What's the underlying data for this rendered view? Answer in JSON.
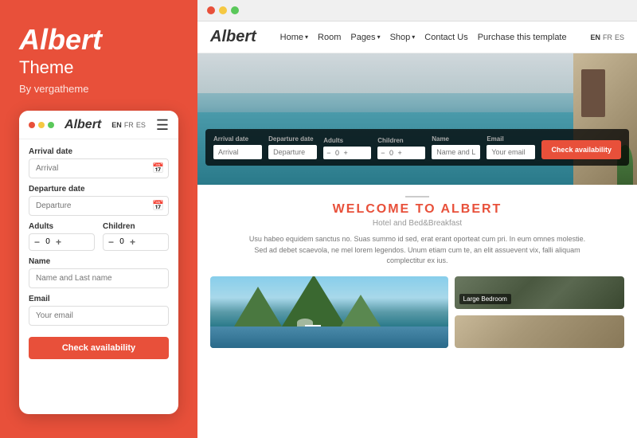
{
  "left": {
    "brand_title": "Albert",
    "brand_subtitle": "Theme",
    "brand_by": "By vergatheme",
    "mobile": {
      "logo": "Albert",
      "lang_options": [
        "EN",
        "FR",
        "ES"
      ],
      "lang_active": "EN",
      "form": {
        "arrival_label": "Arrival date",
        "arrival_placeholder": "Arrival",
        "departure_label": "Departure date",
        "departure_placeholder": "Departure",
        "adults_label": "Adults",
        "adults_value": "0",
        "children_label": "Children",
        "children_value": "0",
        "name_label": "Name",
        "name_placeholder": "Name and Last name",
        "email_label": "Email",
        "email_placeholder": "Your email",
        "check_btn": "Check availability"
      }
    }
  },
  "right": {
    "site": {
      "logo": "Albert",
      "nav": [
        {
          "label": "Home",
          "has_dropdown": true
        },
        {
          "label": "Room",
          "has_dropdown": false
        },
        {
          "label": "Pages",
          "has_dropdown": true
        },
        {
          "label": "Shop",
          "has_dropdown": true
        },
        {
          "label": "Contact Us",
          "has_dropdown": false
        },
        {
          "label": "Purchase this template",
          "has_dropdown": false
        }
      ],
      "lang_options": [
        "EN",
        "FR",
        "ES"
      ],
      "lang_active": "EN"
    },
    "booking_bar": {
      "arrival_label": "Arrival date",
      "arrival_placeholder": "Arrival",
      "departure_label": "Departure date",
      "departure_placeholder": "Departure",
      "adults_label": "Adults",
      "adults_value": "0",
      "children_label": "Children",
      "children_value": "0",
      "name_label": "Name",
      "name_placeholder": "Name and Last name",
      "email_label": "Email",
      "email_placeholder": "Your email",
      "check_btn": "Check availability"
    },
    "welcome": {
      "title": "WELCOME TO ALBERT",
      "subtitle": "Hotel and Bed&Breakfast",
      "text": "Usu habeo equidem sanctus no. Suas summo id sed, erat erant oporteat cum pri. In eum omnes molestie. Sed ad debet scaevola, ne mel lorem legendos. Unum etiam cum te, an elit assuevent vix, falli aliquam complectitur ex ius."
    },
    "gallery": [
      {
        "label": "",
        "type": "pool"
      },
      {
        "label": "Large Bedroom",
        "type": "bedroom"
      },
      {
        "label": "",
        "type": "room2"
      }
    ]
  },
  "browser_dots": [
    "red",
    "yellow",
    "green"
  ],
  "colors": {
    "accent": "#e8503a",
    "dot_red": "#e8503a",
    "dot_yellow": "#f5c842",
    "dot_green": "#5ac85a"
  }
}
